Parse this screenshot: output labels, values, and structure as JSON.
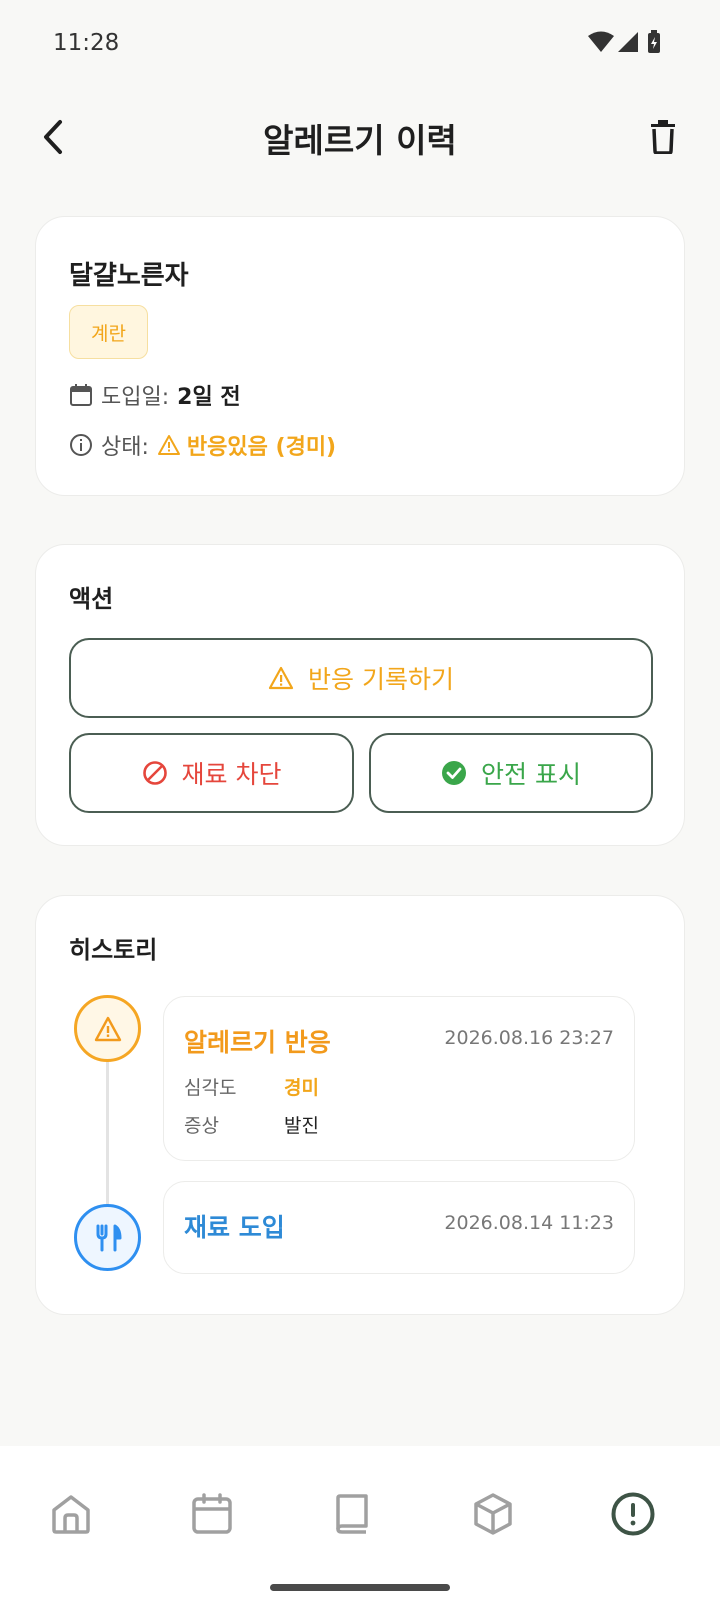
{
  "status_bar": {
    "time": "11:28"
  },
  "header": {
    "title": "알레르기 이력"
  },
  "food": {
    "name": "달걀노른자",
    "tag": "계란",
    "intro_label": "도입일:",
    "intro_value": "2일 전",
    "status_label": "상태:",
    "status_value": "반응있음 (경미)"
  },
  "actions": {
    "title": "액션",
    "record_label": "반응 기록하기",
    "block_label": "재료 차단",
    "safe_label": "안전 표시"
  },
  "history": {
    "title": "히스토리",
    "events": [
      {
        "title": "알레르기 반응",
        "time": "2026.08.16 23:27",
        "details": [
          {
            "key": "심각도",
            "value": "경미"
          },
          {
            "key": "증상",
            "value": "발진"
          }
        ]
      },
      {
        "title": "재료 도입",
        "time": "2026.08.14 11:23"
      }
    ]
  },
  "colors": {
    "accent_warning": "#f2a61b",
    "danger": "#e5463c",
    "success": "#3aa64a",
    "info": "#2e8ad6",
    "outline": "#4b5e53"
  },
  "nav": {
    "items": [
      "home-icon",
      "calendar-icon",
      "book-icon",
      "box-icon",
      "alert-circle-icon"
    ],
    "active": "alert-circle-icon"
  }
}
